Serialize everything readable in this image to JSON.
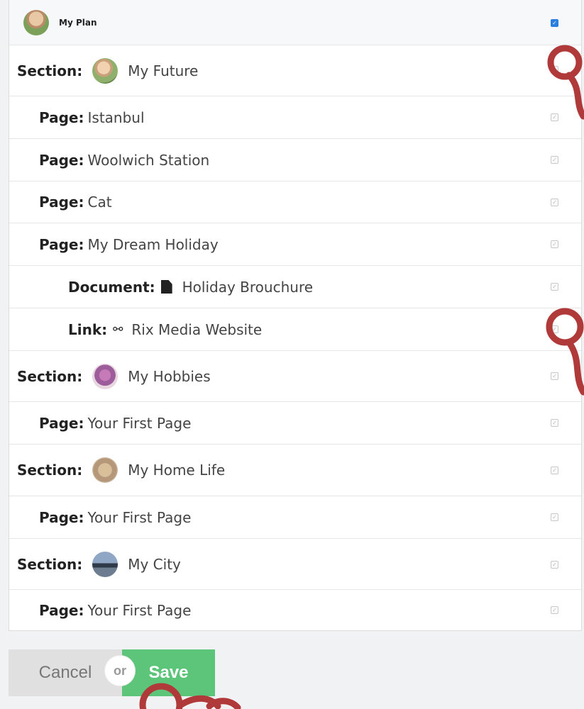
{
  "plan": {
    "title": "My Plan"
  },
  "labels": {
    "section": "Section:",
    "page": "Page:",
    "document": "Document:",
    "link": "Link:"
  },
  "items": {
    "future": {
      "name": "My Future"
    },
    "istanbul": {
      "name": "Istanbul"
    },
    "woolwich": {
      "name": "Woolwich Station"
    },
    "cat": {
      "name": "Cat"
    },
    "dream": {
      "name": "My Dream Holiday"
    },
    "brochure": {
      "name": "Holiday Brouchure"
    },
    "rix": {
      "name": "Rix Media Website"
    },
    "hobbies": {
      "name": "My Hobbies"
    },
    "hobbies_page": {
      "name": "Your First Page"
    },
    "home": {
      "name": "My Home Life"
    },
    "home_page": {
      "name": "Your First Page"
    },
    "city": {
      "name": "My City"
    },
    "city_page": {
      "name": "Your First Page"
    }
  },
  "checkboxes": {
    "plan": true,
    "future": false,
    "istanbul": false,
    "woolwich": false,
    "cat": false,
    "dream": false,
    "brochure": false,
    "rix": false,
    "hobbies": false,
    "hobbies_page": false,
    "home": false,
    "home_page": false,
    "city": false,
    "city_page": false
  },
  "footer": {
    "cancel": "Cancel",
    "or": "or",
    "save": "Save"
  },
  "colors": {
    "accent": "#2a7ee0",
    "save": "#5cc57a",
    "cancel": "#e0e0e0",
    "pointer": "#b03a3a"
  },
  "icons": {
    "document": "document-icon",
    "link": "link-icon",
    "pointer": "pointer-hand-icon"
  }
}
